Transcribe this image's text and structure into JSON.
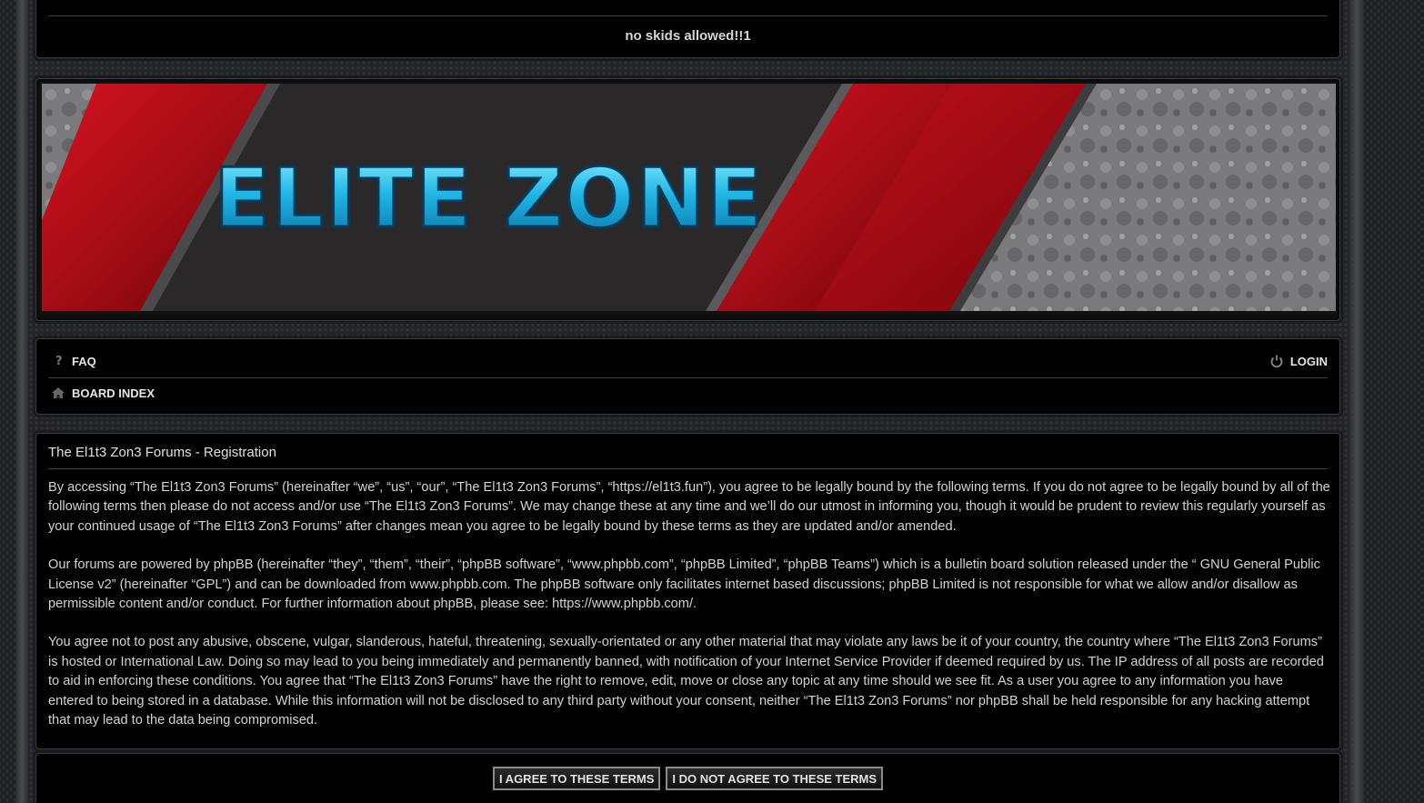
{
  "motto": "no skids allowed!!1",
  "banner": {
    "logo_text": "ELITE ZONE"
  },
  "nav": {
    "faq_label": "FAQ",
    "login_label": "LOGIN",
    "board_index_label": "BOARD INDEX",
    "icons": [
      "question-icon",
      "power-icon",
      "home-icon"
    ]
  },
  "content": {
    "title": "The El1t3 Zon3 Forums - Registration",
    "paragraphs": [
      "By accessing “The El1t3 Zon3 Forums” (hereinafter “we”, “us”, “our”, “The El1t3 Zon3 Forums”, “https://el1t3.fun”), you agree to be legally bound by the following terms. If you do not agree to be legally bound by all of the following terms then please do not access and/or use “The El1t3 Zon3 Forums”. We may change these at any time and we’ll do our utmost in informing you, though it would be prudent to review this regularly yourself as your continued usage of “The El1t3 Zon3 Forums” after changes mean you agree to be legally bound by these terms as they are updated and/or amended.",
      "Our forums are powered by phpBB (hereinafter “they”, “them”, “their”, “phpBB software”, “www.phpbb.com”, “phpBB Limited”, “phpBB Teams”) which is a bulletin board solution released under the “ GNU General Public License v2” (hereinafter “GPL”) and can be downloaded from www.phpbb.com. The phpBB software only facilitates internet based discussions; phpBB Limited is not responsible for what we allow and/or disallow as permissible content and/or conduct. For further information about phpBB, please see: https://www.phpbb.com/.",
      "You agree not to post any abusive, obscene, vulgar, slanderous, hateful, threatening, sexually-orientated or any other material that may violate any laws be it of your country, the country where “The El1t3 Zon3 Forums” is hosted or International Law. Doing so may lead to you being immediately and permanently banned, with notification of your Internet Service Provider if deemed required by us. The IP address of all posts are recorded to aid in enforcing these conditions. You agree that “The El1t3 Zon3 Forums” have the right to remove, edit, move or close any topic at any time should we see fit. As a user you agree to any information you have entered to being stored in a database. While this information will not be disclosed to any third party without your consent, neither “The El1t3 Zon3 Forums” nor phpBB shall be held responsible for any hacking attempt that may lead to the data being compromised."
    ]
  },
  "buttons": {
    "agree_label": "I AGREE TO THESE TERMS",
    "disagree_label": "I DO NOT AGREE TO THESE TERMS"
  },
  "colors": {
    "accent_red": "#b3101a",
    "logo_cyan": "#1fb6e6",
    "panel_bg": "#000000"
  }
}
